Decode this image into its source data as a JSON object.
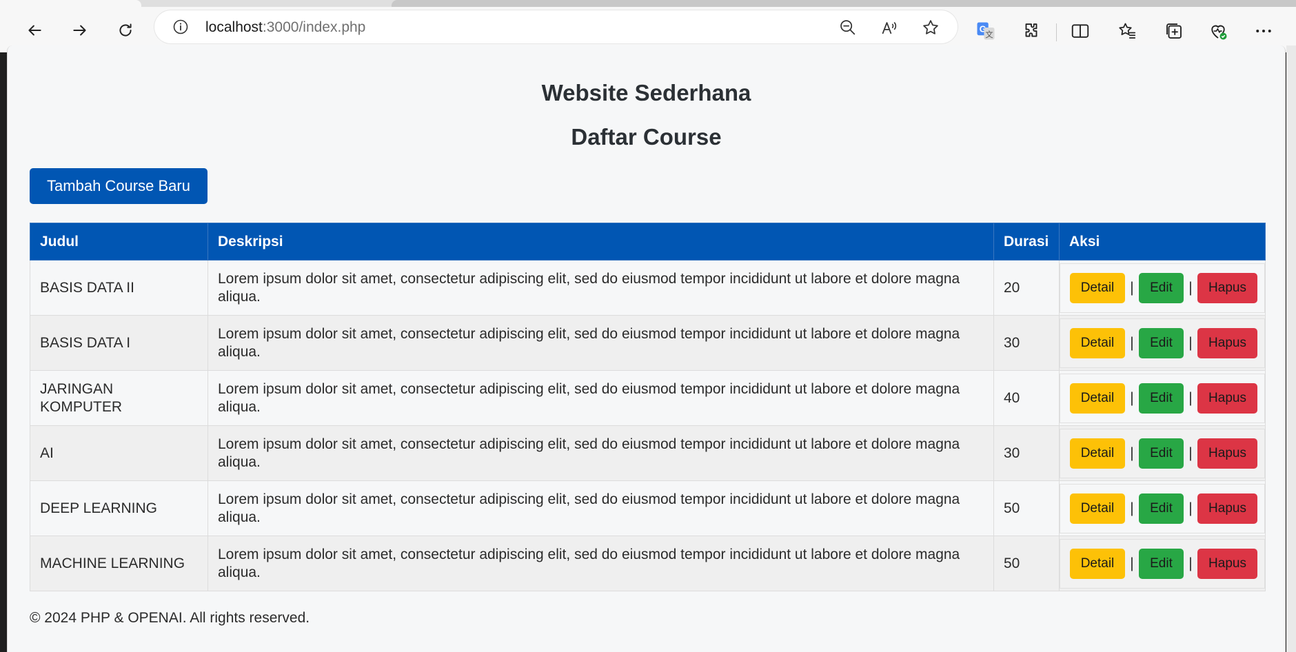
{
  "browser": {
    "url_host": "localhost",
    "url_path": ":3000/index.php"
  },
  "page": {
    "title": "Website Sederhana",
    "subtitle": "Daftar Course",
    "add_button": "Tambah Course Baru",
    "footer": "© 2024 PHP & OPENAI. All rights reserved."
  },
  "table": {
    "headers": {
      "judul": "Judul",
      "deskripsi": "Deskripsi",
      "durasi": "Durasi",
      "aksi": "Aksi"
    },
    "action_labels": {
      "detail": "Detail",
      "edit": "Edit",
      "hapus": "Hapus",
      "separator": "|"
    },
    "rows": [
      {
        "judul": "BASIS DATA II",
        "deskripsi": "Lorem ipsum dolor sit amet, consectetur adipiscing elit, sed do eiusmod tempor incididunt ut labore et dolore magna aliqua.",
        "durasi": "20"
      },
      {
        "judul": "BASIS DATA I",
        "deskripsi": "Lorem ipsum dolor sit amet, consectetur adipiscing elit, sed do eiusmod tempor incididunt ut labore et dolore magna aliqua.",
        "durasi": "30"
      },
      {
        "judul": "JARINGAN KOMPUTER",
        "deskripsi": "Lorem ipsum dolor sit amet, consectetur adipiscing elit, sed do eiusmod tempor incididunt ut labore et dolore magna aliqua.",
        "durasi": "40"
      },
      {
        "judul": "AI",
        "deskripsi": "Lorem ipsum dolor sit amet, consectetur adipiscing elit, sed do eiusmod tempor incididunt ut labore et dolore magna aliqua.",
        "durasi": "30"
      },
      {
        "judul": "DEEP LEARNING",
        "deskripsi": "Lorem ipsum dolor sit amet, consectetur adipiscing elit, sed do eiusmod tempor incididunt ut labore et dolore magna aliqua.",
        "durasi": "50"
      },
      {
        "judul": "MACHINE LEARNING",
        "deskripsi": "Lorem ipsum dolor sit amet, consectetur adipiscing elit, sed do eiusmod tempor incididunt ut labore et dolore magna aliqua.",
        "durasi": "50"
      }
    ]
  },
  "colors": {
    "primary": "#0156b3",
    "detail": "#fdc107",
    "edit": "#28a745",
    "hapus": "#dc3545"
  }
}
